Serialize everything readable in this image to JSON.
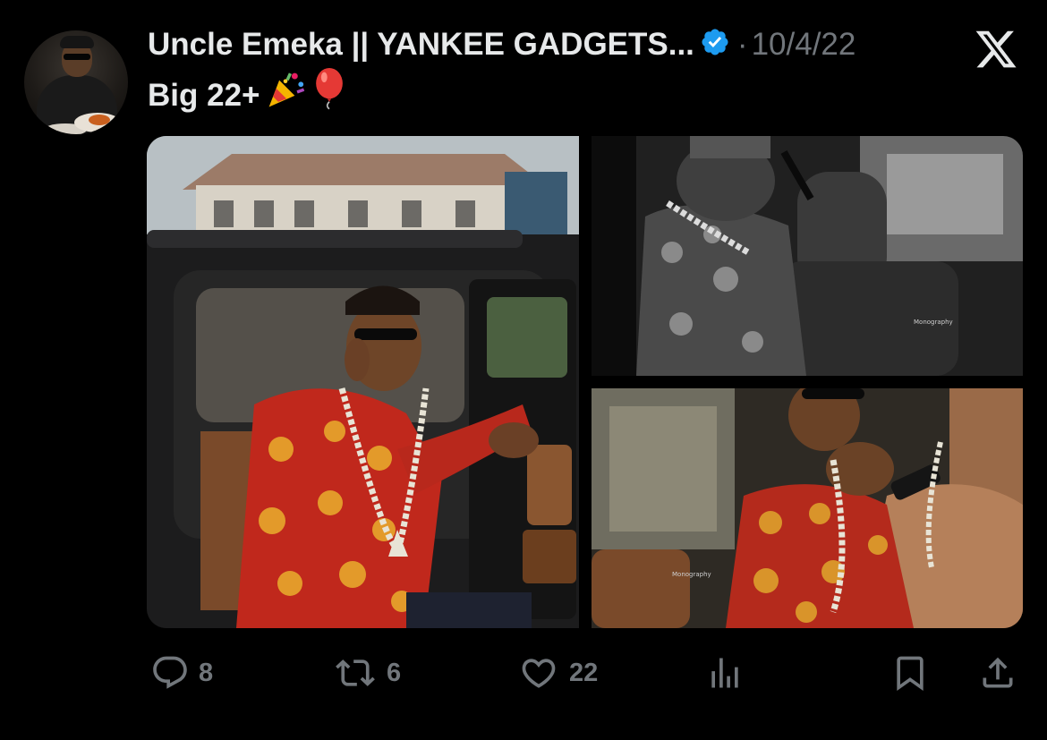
{
  "tweet": {
    "author": "Uncle Emeka || YANKEE GADGETS...",
    "separator": "·",
    "date": "10/4/22",
    "text": "Big 22+",
    "emojis": [
      "party-popper-icon",
      "red-balloon-icon"
    ]
  },
  "actions": {
    "reply_count": "8",
    "retweet_count": "6",
    "like_count": "22"
  },
  "colors": {
    "background": "#000000",
    "text_primary": "#e7e9ea",
    "text_secondary": "#71767b",
    "verified_blue": "#1d9bf0"
  },
  "icons": [
    "verified-icon",
    "x-logo-icon",
    "reply-icon",
    "retweet-icon",
    "like-icon",
    "views-icon",
    "bookmark-icon",
    "share-icon"
  ]
}
